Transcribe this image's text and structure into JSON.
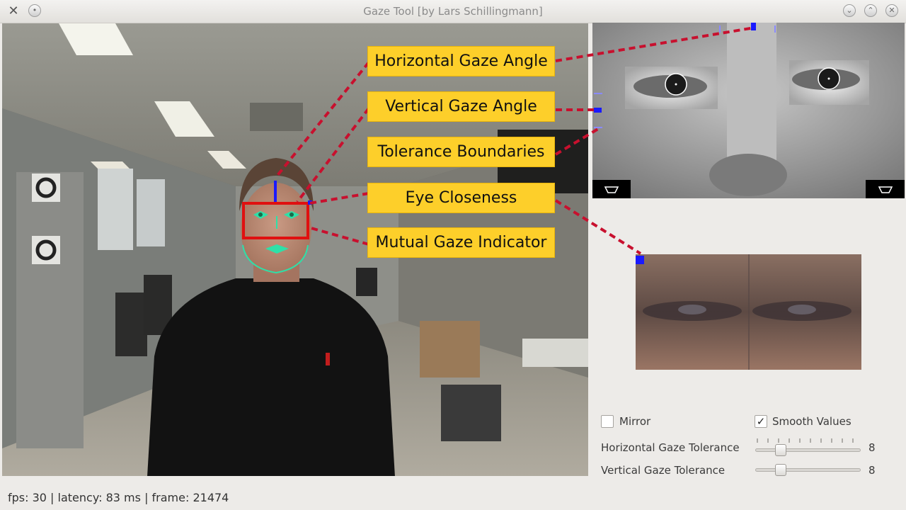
{
  "window": {
    "title": "Gaze Tool  [by Lars Schillingmann]"
  },
  "annotations": [
    {
      "text": "Horizontal Gaze Angle"
    },
    {
      "text": "Vertical Gaze Angle"
    },
    {
      "text": "Tolerance Boundaries"
    },
    {
      "text": "Eye Closeness"
    },
    {
      "text": "Mutual Gaze Indicator"
    }
  ],
  "controls": {
    "mirror": {
      "label": "Mirror",
      "checked": false
    },
    "smooth": {
      "label": "Smooth Values",
      "checked": true,
      "mark": "✓"
    },
    "horizontal_tolerance": {
      "label": "Horizontal Gaze Tolerance",
      "value": "8",
      "level": 0.2
    },
    "vertical_tolerance": {
      "label": "Vertical Gaze Tolerance",
      "value": "8",
      "level": 0.2
    }
  },
  "status": {
    "text": "fps: 30 | latency: 83 ms | frame: 21474"
  },
  "colors": {
    "annotation_fill": "#fdcf2a",
    "connector": "#c8102e",
    "mutual_gaze_box": "#e01010",
    "gaze_marker": "#1a1aff",
    "landmarks": "#2ee0a8"
  }
}
